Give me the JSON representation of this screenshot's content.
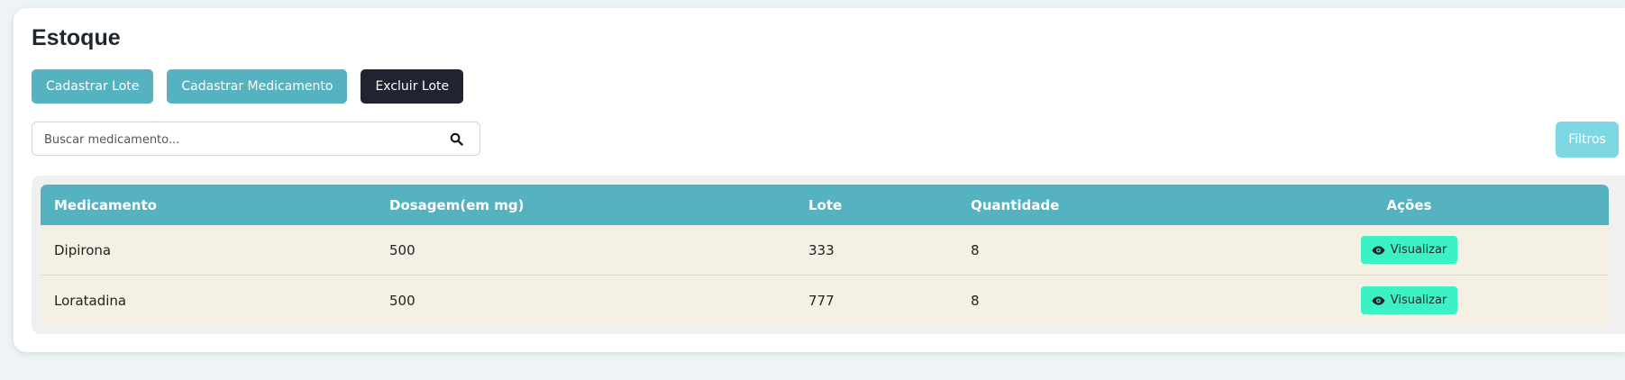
{
  "page": {
    "title": "Estoque"
  },
  "actions": {
    "register_batch": "Cadastrar Lote",
    "register_medication": "Cadastrar Medicamento",
    "delete_batch": "Excluir Lote"
  },
  "search": {
    "placeholder": "Buscar medicamento...",
    "value": "",
    "icon": "search-icon"
  },
  "filters": {
    "label": "Filtros"
  },
  "table": {
    "headers": [
      "Medicamento",
      "Dosagem(em mg)",
      "Lote",
      "Quantidade",
      "Ações"
    ],
    "rows": [
      {
        "medication": "Dipirona",
        "dosage": "500",
        "batch": "333",
        "quantity": "8",
        "action": "Visualizar"
      },
      {
        "medication": "Loratadina",
        "dosage": "500",
        "batch": "777",
        "quantity": "8",
        "action": "Visualizar"
      }
    ]
  },
  "colors": {
    "primary": "#55b2c1",
    "dark": "#1f2430",
    "filters": "#7dd8e3",
    "view_button": "#3cf2c4",
    "row_background": "#f5f0e4"
  }
}
